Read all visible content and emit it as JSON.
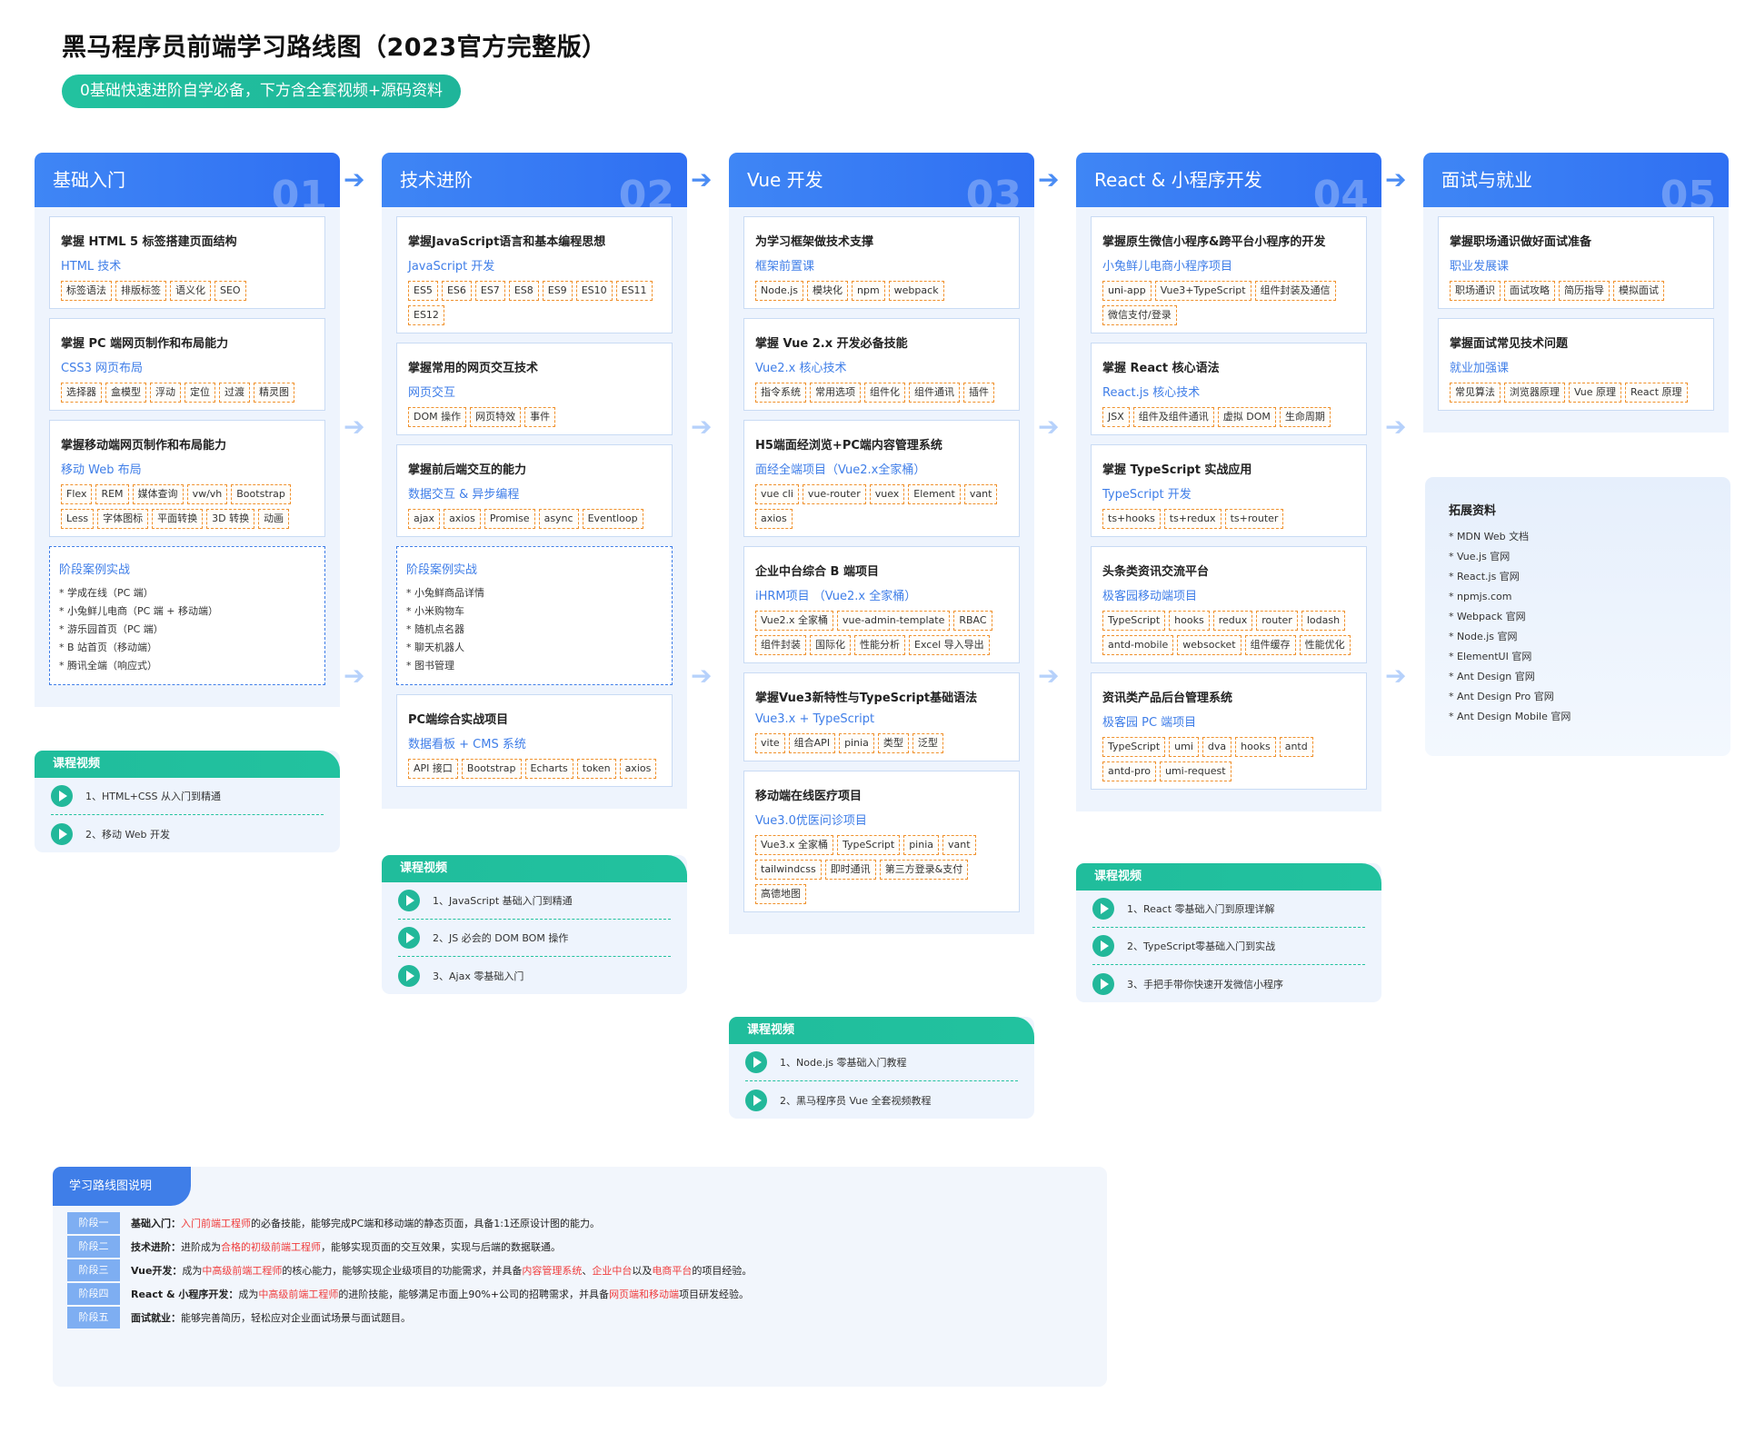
{
  "title": "黑马程序员前端学习路线图（2023官方完整版）",
  "subtitle_pill": "0基础快速进阶自学必备，下方含全套视频+源码资料",
  "columns": [
    {
      "title": "基础入门",
      "num": "01"
    },
    {
      "title": "技术进阶",
      "num": "02"
    },
    {
      "title": "Vue 开发",
      "num": "03"
    },
    {
      "title": "React & 小程序开发",
      "num": "04"
    },
    {
      "title": "面试与就业",
      "num": "05"
    }
  ],
  "c1": {
    "cards": [
      {
        "title": "掌握 HTML 5 标签搭建页面结构",
        "sub": "HTML 技术",
        "tags": [
          "标签语法",
          "排版标签",
          "语义化",
          "SEO"
        ]
      },
      {
        "title": "掌握 PC 端网页制作和布局能力",
        "sub": "CSS3 网页布局",
        "tags": [
          "选择器",
          "盒模型",
          "浮动",
          "定位",
          "过渡",
          "精灵图"
        ]
      },
      {
        "title": "掌握移动端网页制作和布局能力",
        "sub": "移动 Web 布局",
        "tags": [
          "Flex",
          "REM",
          "媒体查询",
          "vw/vh",
          "Bootstrap",
          "Less",
          "字体图标",
          "平面转换",
          "3D 转换",
          "动画"
        ]
      }
    ],
    "case": {
      "title": "阶段案例实战",
      "items": [
        "* 学成在线（PC 端）",
        "* 小兔鲜儿电商（PC 端 + 移动端）",
        "* 游乐园首页（PC 端）",
        "* B 站首页（移动端）",
        "* 腾讯全端（响应式）"
      ]
    }
  },
  "c2": {
    "cards": [
      {
        "title": "掌握JavaScript语言和基本编程思想",
        "sub": "JavaScript 开发",
        "tags": [
          "ES5",
          "ES6",
          "ES7",
          "ES8",
          "ES9",
          "ES10",
          "ES11",
          "ES12"
        ]
      },
      {
        "title": "掌握常用的网页交互技术",
        "sub": "网页交互",
        "tags": [
          "DOM 操作",
          "网页特效",
          "事件"
        ]
      },
      {
        "title": "掌握前后端交互的能力",
        "sub": "数据交互 & 异步编程",
        "tags": [
          "ajax",
          "axios",
          "Promise",
          "async",
          "Eventloop"
        ]
      }
    ],
    "case": {
      "title": "阶段案例实战",
      "items": [
        "* 小兔鲜商品详情",
        "* 小米购物车",
        "* 随机点名器",
        "* 聊天机器人",
        "* 图书管理"
      ]
    },
    "cards2": [
      {
        "title": "PC端综合实战项目",
        "sub": "数据看板 + CMS 系统",
        "tags": [
          "API 接口",
          "Bootstrap",
          "Echarts",
          "token",
          "axios"
        ]
      }
    ]
  },
  "c3": {
    "cards": [
      {
        "title": "为学习框架做技术支撑",
        "sub": "框架前置课",
        "tags": [
          "Node.js",
          "模块化",
          "npm",
          "webpack"
        ]
      },
      {
        "title": "掌握 Vue 2.x 开发必备技能",
        "sub": "Vue2.x 核心技术",
        "tags": [
          "指令系统",
          "常用选项",
          "组件化",
          "组件通讯",
          "插件"
        ]
      },
      {
        "title": "H5端面经浏览+PC端内容管理系统",
        "sub": "面经全端项目（Vue2.x全家桶）",
        "tags": [
          "vue cli",
          "vue-router",
          "vuex",
          "Element",
          "vant",
          "axios"
        ]
      },
      {
        "title": "企业中台综合 B 端项目",
        "sub": "iHRM项目 （Vue2.x 全家桶）",
        "tags": [
          "Vue2.x 全家桶",
          "vue-admin-template",
          "RBAC",
          "组件封装",
          "国际化",
          "性能分析",
          "Excel 导入导出"
        ]
      },
      {
        "title": "掌握Vue3新特性与TypeScript基础语法",
        "sub": "Vue3.x + TypeScript",
        "tags": [
          "vite",
          "组合API",
          "pinia",
          "类型",
          "泛型"
        ]
      },
      {
        "title": "移动端在线医疗项目",
        "sub": "Vue3.0优医问诊项目",
        "tags": [
          "Vue3.x 全家桶",
          "TypeScript",
          "pinia",
          "vant",
          "tailwindcss",
          "即时通讯",
          "第三方登录&支付",
          "高德地图"
        ]
      }
    ]
  },
  "c4": {
    "cards": [
      {
        "title": "掌握原生微信小程序&跨平台小程序的开发",
        "sub": "小兔鲜儿电商小程序项目",
        "tags": [
          "uni-app",
          "Vue3+TypeScript",
          "组件封装及通信",
          "微信支付/登录"
        ]
      },
      {
        "title": "掌握 React 核心语法",
        "sub": "React.js 核心技术",
        "tags": [
          "JSX",
          "组件及组件通讯",
          "虚拟 DOM",
          "生命周期"
        ]
      },
      {
        "title": "掌握 TypeScript 实战应用",
        "sub": "TypeScript 开发",
        "tags": [
          "ts+hooks",
          "ts+redux",
          "ts+router"
        ]
      },
      {
        "title": "头条类资讯交流平台",
        "sub": "极客园移动端项目",
        "tags": [
          "TypeScript",
          "hooks",
          "redux",
          "router",
          "lodash",
          "antd-mobile",
          "websocket",
          "组件缓存",
          "性能优化"
        ]
      },
      {
        "title": "资讯类产品后台管理系统",
        "sub": "极客园 PC 端项目",
        "tags": [
          "TypeScript",
          "umi",
          "dva",
          "hooks",
          "antd",
          "antd-pro",
          "umi-request"
        ]
      }
    ]
  },
  "c5": {
    "cards": [
      {
        "title": "掌握职场通识做好面试准备",
        "sub": "职业发展课",
        "tags": [
          "职场通识",
          "面试攻略",
          "简历指导",
          "模拟面试"
        ]
      },
      {
        "title": "掌握面试常见技术问题",
        "sub": "就业加强课",
        "tags": [
          "常见算法",
          "浏览器原理",
          "Vue 原理",
          "React 原理"
        ]
      }
    ],
    "ext": {
      "title": "拓展资料",
      "items": [
        "* MDN Web 文档",
        "* Vue.js 官网",
        "* React.js 官网",
        "* npmjs.com",
        "* Webpack 官网",
        "* Node.js 官网",
        "* ElementUI 官网",
        "* Ant Design 官网",
        "* Ant Design Pro 官网",
        "* Ant Design Mobile 官网"
      ]
    }
  },
  "videos": {
    "label": "课程视频",
    "v1": [
      "1、HTML+CSS 从入门到精通",
      "2、移动 Web 开发"
    ],
    "v2": [
      "1、JavaScript 基础入门到精通",
      "2、JS 必会的 DOM BOM 操作",
      "3、Ajax 零基础入门"
    ],
    "v3": [
      "1、Node.js 零基础入门教程",
      "2、黑马程序员 Vue 全套视频教程"
    ],
    "v4": [
      "1、React 零基础入门到原理详解",
      "2、TypeScript零基础入门到实战",
      "3、手把手带你快速开发微信小程序"
    ]
  },
  "legend": {
    "title": "学习路线图说明",
    "rows": [
      {
        "badge": "阶段一",
        "name": "基础入门：",
        "parts": [
          [
            "n",
            "  "
          ],
          [
            "r",
            "入门前端工程师"
          ],
          [
            "n",
            "的必备技能，能够完成PC端和移动端的静态页面，具备1:1还原设计图的能力。"
          ]
        ]
      },
      {
        "badge": "阶段二",
        "name": "技术进阶：",
        "parts": [
          [
            "n",
            "  进阶成为"
          ],
          [
            "r",
            "合格的初级前端工程师"
          ],
          [
            "n",
            "，能够实现页面的交互效果，实现与后端的数据联通。"
          ]
        ]
      },
      {
        "badge": "阶段三",
        "name": "Vue开发：",
        "parts": [
          [
            "n",
            "  成为"
          ],
          [
            "r",
            "中高级前端工程师"
          ],
          [
            "n",
            "的核心能力，能够实现企业级项目的功能需求，并具备"
          ],
          [
            "r",
            "内容管理系统"
          ],
          [
            "n",
            "、"
          ],
          [
            "r",
            "企业中台"
          ],
          [
            "n",
            "以及"
          ],
          [
            "r",
            "电商平台"
          ],
          [
            "n",
            "的项目经验。"
          ]
        ]
      },
      {
        "badge": "阶段四",
        "name": "React & 小程序开发：",
        "parts": [
          [
            "n",
            "  成为"
          ],
          [
            "r",
            "中高级前端工程师"
          ],
          [
            "n",
            "的进阶技能，能够满足市面上90%+公司的招聘需求，并具备"
          ],
          [
            "r",
            "网页端和移动端"
          ],
          [
            "n",
            "项目研发经验。"
          ]
        ]
      },
      {
        "badge": "阶段五",
        "name": "面试就业：",
        "parts": [
          [
            "n",
            "  能够完善简历，轻松应对企业面试场景与面试题目。"
          ]
        ]
      }
    ]
  }
}
